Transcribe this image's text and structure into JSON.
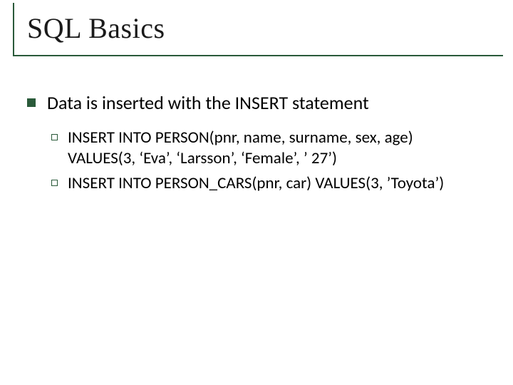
{
  "title": "SQL Basics",
  "bullets": {
    "main": "Data is inserted with the INSERT statement",
    "subs": [
      "INSERT INTO PERSON(pnr, name, surname, sex, age) VALUES(3, ‘Eva’, ‘Larsson’, ‘Female’, ’ 27’)",
      "INSERT INTO PERSON_CARS(pnr, car) VALUES(3, ’Toyota’)"
    ]
  }
}
